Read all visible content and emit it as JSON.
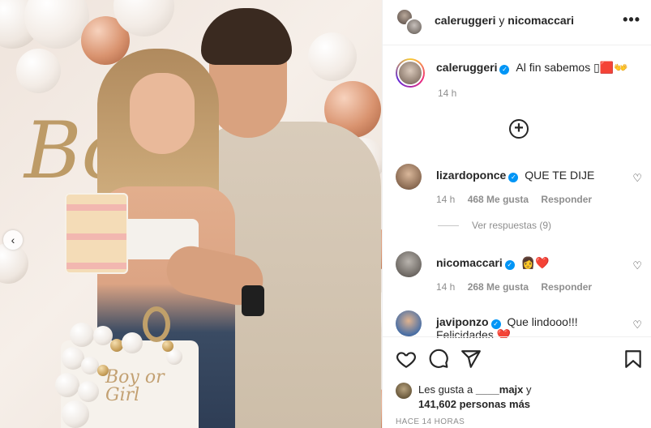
{
  "header": {
    "user1": "caleruggeri",
    "conj": "y",
    "user2": "nicomaccari",
    "more_icon": "•••"
  },
  "caption": {
    "username": "caleruggeri",
    "text": "Al fin sabemos",
    "emoji": "▯🟥👐",
    "time": "14 h"
  },
  "comments": [
    {
      "username": "lizardoponce",
      "text": "QUE TE DIJE",
      "time": "14 h",
      "likes": "468 Me gusta",
      "reply": "Responder",
      "replies": "Ver respuestas (9)"
    },
    {
      "username": "nicomaccari",
      "text": "👩❤️",
      "time": "14 h",
      "likes": "268 Me gusta",
      "reply": "Responder"
    },
    {
      "username": "javiponzo",
      "text": "Que lindooo!!!",
      "text2": "Felicidades ❤️"
    }
  ],
  "likes": {
    "prefix": "Les gusta a",
    "user": "____majx",
    "suffix": "y",
    "count": "141,602 personas más"
  },
  "posted": "HACE 14 HORAS",
  "photo": {
    "cake_text": "Boy or Girl",
    "carousel_prev": "‹"
  },
  "icons": {
    "heart": "heart-icon",
    "comment": "comment-icon",
    "share": "share-icon",
    "save": "bookmark-icon",
    "add": "plus-circle-icon",
    "verified": "verified-badge-icon"
  },
  "colors": {
    "verified": "#0095f6",
    "muted": "#8e8e8e",
    "text": "#262626",
    "heart_red": "#ed4956"
  }
}
